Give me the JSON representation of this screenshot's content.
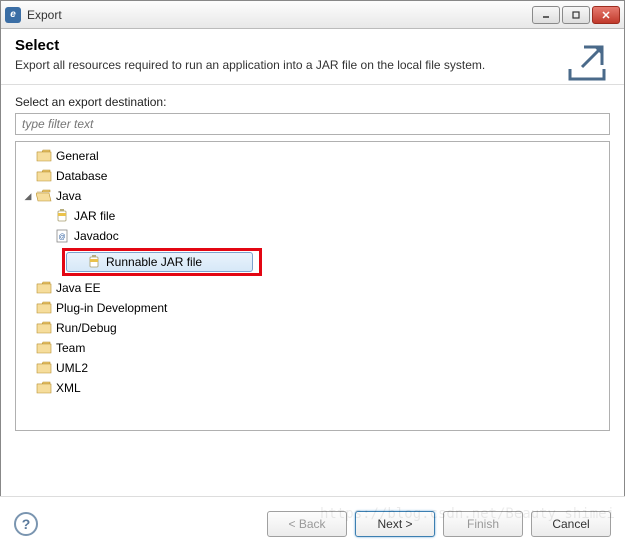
{
  "window": {
    "title": "Export"
  },
  "header": {
    "title": "Select",
    "subtitle": "Export all resources required to run an application into a JAR file on the local file system."
  },
  "body": {
    "destLabel": "Select an export destination:",
    "filterPlaceholder": "type filter text"
  },
  "tree": {
    "nodes": [
      {
        "label": "General",
        "kind": "folder",
        "expanded": false
      },
      {
        "label": "Database",
        "kind": "folder",
        "expanded": false
      },
      {
        "label": "Java",
        "kind": "folder-open",
        "expanded": true,
        "children": [
          {
            "label": "JAR file",
            "kind": "jar"
          },
          {
            "label": "Javadoc",
            "kind": "javadoc"
          },
          {
            "label": "Runnable JAR file",
            "kind": "jar",
            "selected": true,
            "highlighted": true
          }
        ]
      },
      {
        "label": "Java EE",
        "kind": "folder",
        "expanded": false
      },
      {
        "label": "Plug-in Development",
        "kind": "folder",
        "expanded": false
      },
      {
        "label": "Run/Debug",
        "kind": "folder",
        "expanded": false
      },
      {
        "label": "Team",
        "kind": "folder",
        "expanded": false
      },
      {
        "label": "UML2",
        "kind": "folder",
        "expanded": false
      },
      {
        "label": "XML",
        "kind": "folder",
        "expanded": false
      }
    ]
  },
  "footer": {
    "back": "< Back",
    "next": "Next >",
    "finish": "Finish",
    "cancel": "Cancel"
  },
  "watermark": "https://blog.csdn.net/Beauty_shimei"
}
